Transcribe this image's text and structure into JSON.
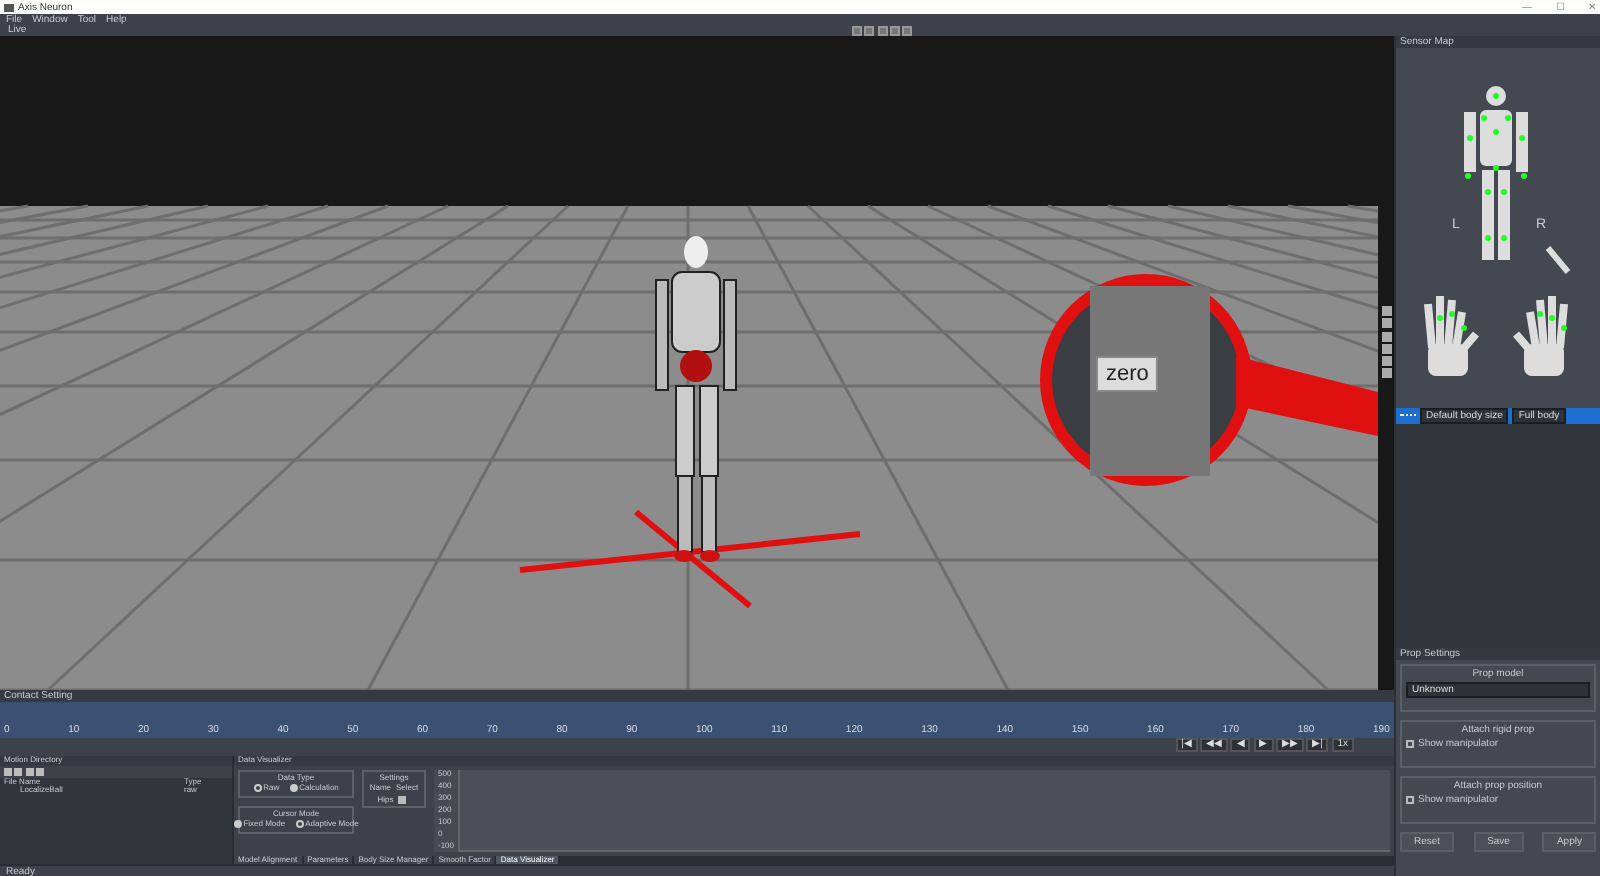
{
  "window": {
    "title": "Axis Neuron",
    "controls": [
      "—",
      "☐",
      "✕"
    ]
  },
  "menu": [
    "File",
    "Window",
    "Tool",
    "Help"
  ],
  "toolbar": {
    "mode": "Live"
  },
  "viewport": {
    "callout": {
      "button": "zero"
    }
  },
  "sensor_map": {
    "title": "Sensor Map",
    "side_labels": [
      "L",
      "R"
    ],
    "body_size": "Default body size",
    "body_mode": "Full body"
  },
  "timeline": {
    "title": "Contact Setting",
    "ticks": [
      "0",
      "10",
      "20",
      "30",
      "40",
      "50",
      "60",
      "70",
      "80",
      "90",
      "100",
      "110",
      "120",
      "130",
      "140",
      "150",
      "160",
      "170",
      "180",
      "190"
    ],
    "controls": [
      "|◀",
      "◀◀",
      "◀",
      "▶",
      "▶▶",
      "▶|"
    ],
    "speed": "1x"
  },
  "motion_directory": {
    "title": "Motion Directory",
    "columns": [
      "File Name",
      "Type"
    ],
    "rows": [
      [
        "LocalizeBall",
        "raw"
      ]
    ]
  },
  "data_visualizer": {
    "title": "Data Visualizer",
    "data_type": {
      "title": "Data Type",
      "options": [
        {
          "label": "Raw",
          "selected": false
        },
        {
          "label": "Calculation",
          "selected": true
        }
      ]
    },
    "cursor_mode": {
      "title": "Cursor Mode",
      "options": [
        {
          "label": "Fixed Mode",
          "selected": true
        },
        {
          "label": "Adaptive Mode",
          "selected": false
        }
      ]
    },
    "settings": {
      "title": "Settings",
      "columns": [
        "Name",
        "Select"
      ],
      "rows": [
        {
          "name": "Hips",
          "checked": true
        }
      ]
    },
    "y_labels": [
      "500",
      "400",
      "300",
      "200",
      "100",
      "0",
      "-100"
    ],
    "tabs": [
      {
        "label": "Model Alignment",
        "selected": false
      },
      {
        "label": "Parameters",
        "selected": false
      },
      {
        "label": "Body Size Manager",
        "selected": false
      },
      {
        "label": "Smooth Factor",
        "selected": false
      },
      {
        "label": "Data Visualizer",
        "selected": true
      }
    ]
  },
  "prop_settings": {
    "title": "Prop Settings",
    "groups": [
      {
        "title": "Prop model",
        "kind": "select",
        "value": "Unknown"
      },
      {
        "title": "Attach rigid prop",
        "kind": "check",
        "label": "Show manipulator",
        "checked": false
      },
      {
        "title": "Attach prop position",
        "kind": "check",
        "label": "Show manipulator",
        "checked": false
      }
    ],
    "buttons": [
      "Reset",
      "Save",
      "Apply"
    ]
  },
  "status_bar": "Ready"
}
